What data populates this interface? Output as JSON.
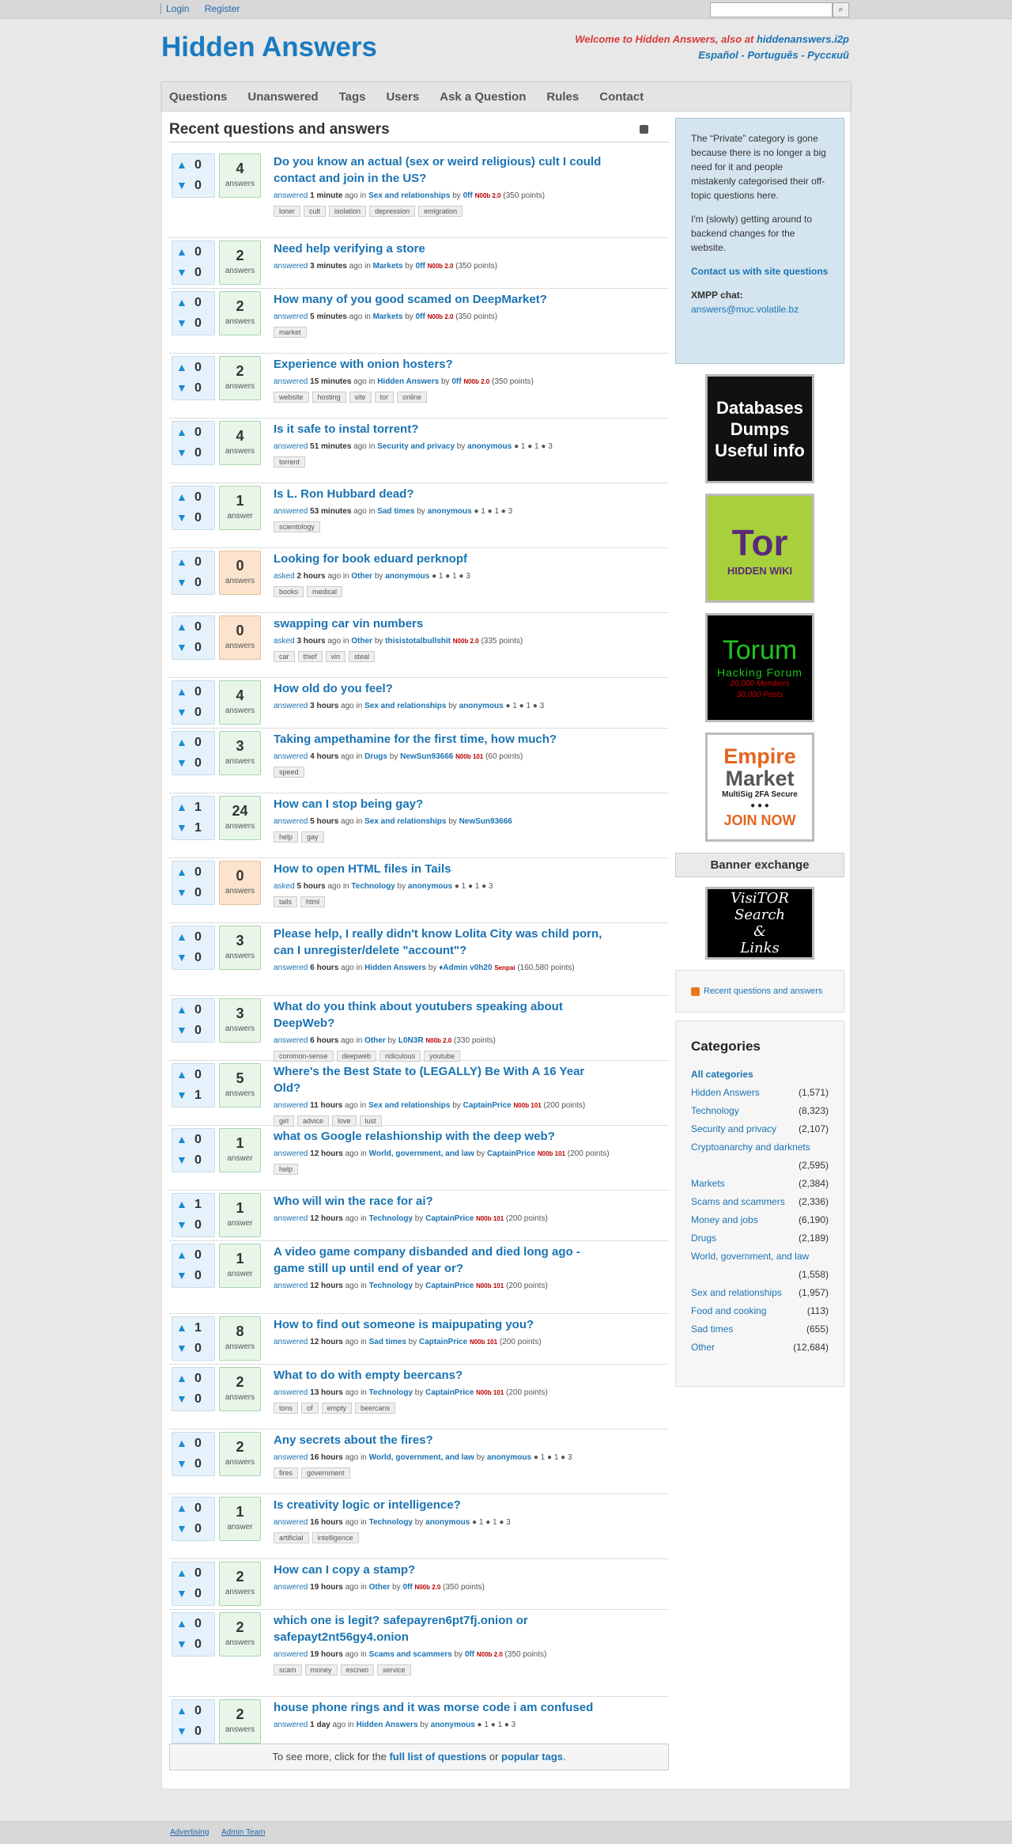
{
  "topbar": {
    "login": "Login",
    "register": "Register",
    "search_btn": "⌕"
  },
  "site": {
    "title": "Hidden Answers",
    "welcome_text": "Welcome to Hidden Answers, also at ",
    "welcome_link": "hiddenanswers.i2p",
    "languages": "Español - Português - Русский"
  },
  "nav": [
    "Questions",
    "Unanswered",
    "Tags",
    "Users",
    "Ask a Question",
    "Rules",
    "Contact"
  ],
  "heading": "Recent questions and answers",
  "questions": [
    {
      "up": "0",
      "down": "0",
      "count": "4",
      "unit": "answers",
      "title": "Do you know an actual (sex or weird religious) cult I could contact and join in the US?",
      "verb": "answered",
      "time": "1 minute",
      "cat": "Sex and relationships",
      "by": "0ff",
      "badge": "N00b 2.0",
      "pts": "(350 points)",
      "tags": [
        "loner",
        "cult",
        "isolation",
        "depression",
        "emigration"
      ],
      "h": 2
    },
    {
      "up": "0",
      "down": "0",
      "count": "2",
      "unit": "answers",
      "title": "Need help verifying a store",
      "verb": "answered",
      "time": "3 minutes",
      "cat": "Markets",
      "by": "0ff",
      "badge": "N00b 2.0",
      "pts": "(350 points)",
      "tags": [],
      "h": 1
    },
    {
      "up": "0",
      "down": "0",
      "count": "2",
      "unit": "answers",
      "title": "How many of you good scamed on DeepMarket?",
      "verb": "answered",
      "time": "5 minutes",
      "cat": "Markets",
      "by": "0ff",
      "badge": "N00b 2.0",
      "pts": "(350 points)",
      "tags": [
        "market"
      ],
      "h": 1
    },
    {
      "up": "0",
      "down": "0",
      "count": "2",
      "unit": "answers",
      "title": "Experience with onion hosters?",
      "verb": "answered",
      "time": "15 minutes",
      "cat": "Hidden Answers",
      "by": "0ff",
      "badge": "N00b 2.0",
      "pts": "(350 points)",
      "tags": [
        "website",
        "hosting",
        "site",
        "tor",
        "online"
      ],
      "h": 1
    },
    {
      "up": "0",
      "down": "0",
      "count": "4",
      "unit": "answers",
      "title": "Is it safe to instal torrent?",
      "verb": "answered",
      "time": "51 minutes",
      "cat": "Security and privacy",
      "by": "anonymous",
      "badge": "",
      "pts": "● 1 ● 1 ● 3",
      "tags": [
        "torrent"
      ],
      "h": 1
    },
    {
      "up": "0",
      "down": "0",
      "count": "1",
      "unit": "answer",
      "title": "Is L. Ron Hubbard dead?",
      "verb": "answered",
      "time": "53 minutes",
      "cat": "Sad times",
      "by": "anonymous",
      "badge": "",
      "pts": "● 1 ● 1 ● 3",
      "tags": [
        "scientology"
      ],
      "h": 1
    },
    {
      "up": "0",
      "down": "0",
      "count": "0",
      "unit": "answers",
      "title": "Looking for book eduard perknopf",
      "verb": "asked",
      "time": "2 hours",
      "cat": "Other",
      "by": "anonymous",
      "badge": "",
      "pts": "● 1 ● 1 ● 3",
      "tags": [
        "books",
        "medical"
      ],
      "h": 1,
      "zero": true
    },
    {
      "up": "0",
      "down": "0",
      "count": "0",
      "unit": "answers",
      "title": "swapping car vin numbers",
      "verb": "asked",
      "time": "3 hours",
      "cat": "Other",
      "by": "thisistotalbullshit",
      "badge": "N00b 2.0",
      "pts": "(335 points)",
      "tags": [
        "car",
        "thief",
        "vin",
        "steal"
      ],
      "h": 1,
      "zero": true
    },
    {
      "up": "0",
      "down": "0",
      "count": "4",
      "unit": "answers",
      "title": "How old do you feel?",
      "verb": "answered",
      "time": "3 hours",
      "cat": "Sex and relationships",
      "by": "anonymous",
      "badge": "",
      "pts": "● 1 ● 1 ● 3",
      "tags": [],
      "h": 1
    },
    {
      "up": "0",
      "down": "0",
      "count": "3",
      "unit": "answers",
      "title": "Taking ampethamine for the first time, how much?",
      "verb": "answered",
      "time": "4 hours",
      "cat": "Drugs",
      "by": "NewSun93666",
      "badge": "N00b 101",
      "pts": "(60 points)",
      "tags": [
        "speed"
      ],
      "h": 1
    },
    {
      "up": "1",
      "down": "1",
      "count": "24",
      "unit": "answers",
      "title": "How can I stop being gay?",
      "verb": "answered",
      "time": "5 hours",
      "cat": "Sex and relationships",
      "by": "NewSun93666",
      "badge": "",
      "pts": "",
      "tags": [
        "help",
        "gay"
      ],
      "h": 1
    },
    {
      "up": "0",
      "down": "0",
      "count": "0",
      "unit": "answers",
      "title": "How to open HTML files in Tails",
      "verb": "asked",
      "time": "5 hours",
      "cat": "Technology",
      "by": "anonymous",
      "badge": "",
      "pts": "● 1 ● 1 ● 3",
      "tags": [
        "tails",
        "html"
      ],
      "h": 1,
      "zero": true
    },
    {
      "up": "0",
      "down": "0",
      "count": "3",
      "unit": "answers",
      "title": "Please help, I really didn't know Lolita City was child porn, can I unregister/delete \"account\"?",
      "verb": "answered",
      "time": "6 hours",
      "cat": "Hidden Answers",
      "by": "♦Admin v0h20",
      "badge": "Senpai",
      "pts": "(160,580 points)",
      "tags": [],
      "h": 2
    },
    {
      "up": "0",
      "down": "0",
      "count": "3",
      "unit": "answers",
      "title": "What do you think about youtubers speaking about DeepWeb?",
      "verb": "answered",
      "time": "6 hours",
      "cat": "Other",
      "by": "L0N3R",
      "badge": "N00b 2.0",
      "pts": "(330 points)",
      "tags": [
        "common-sense",
        "deepweb",
        "ridiculous",
        "youtube"
      ],
      "h": 1
    },
    {
      "up": "0",
      "down": "1",
      "count": "5",
      "unit": "answers",
      "title": "Where's the Best State to (LEGALLY) Be With A 16 Year Old?",
      "verb": "answered",
      "time": "11 hours",
      "cat": "Sex and relationships",
      "by": "CaptainPrice",
      "badge": "N00b 101",
      "pts": "(200 points)",
      "tags": [
        "girl",
        "advice",
        "love",
        "lust"
      ],
      "h": 1
    },
    {
      "up": "0",
      "down": "0",
      "count": "1",
      "unit": "answer",
      "title": "what os Google relashionship with the deep web?",
      "verb": "answered",
      "time": "12 hours",
      "cat": "World, government, and law",
      "by": "CaptainPrice",
      "badge": "N00b 101",
      "pts": "(200 points)",
      "tags": [
        "help"
      ],
      "h": 1
    },
    {
      "up": "1",
      "down": "0",
      "count": "1",
      "unit": "answer",
      "title": "Who will win the race for ai?",
      "verb": "answered",
      "time": "12 hours",
      "cat": "Technology",
      "by": "CaptainPrice",
      "badge": "N00b 101",
      "pts": "(200 points)",
      "tags": [],
      "h": 1
    },
    {
      "up": "0",
      "down": "0",
      "count": "1",
      "unit": "answer",
      "title": "A video game company disbanded and died long ago - game still up until end of year or?",
      "verb": "answered",
      "time": "12 hours",
      "cat": "Technology",
      "by": "CaptainPrice",
      "badge": "N00b 101",
      "pts": "(200 points)",
      "tags": [],
      "h": 2
    },
    {
      "up": "1",
      "down": "0",
      "count": "8",
      "unit": "answers",
      "title": "How to find out someone is maipupating you?",
      "verb": "answered",
      "time": "12 hours",
      "cat": "Sad times",
      "by": "CaptainPrice",
      "badge": "N00b 101",
      "pts": "(200 points)",
      "tags": [],
      "h": 1
    },
    {
      "up": "0",
      "down": "0",
      "count": "2",
      "unit": "answers",
      "title": "What to do with empty beercans?",
      "verb": "answered",
      "time": "13 hours",
      "cat": "Technology",
      "by": "CaptainPrice",
      "badge": "N00b 101",
      "pts": "(200 points)",
      "tags": [
        "tons",
        "of",
        "empty",
        "beercans"
      ],
      "h": 1
    },
    {
      "up": "0",
      "down": "0",
      "count": "2",
      "unit": "answers",
      "title": "Any secrets about the fires?",
      "verb": "answered",
      "time": "16 hours",
      "cat": "World, government, and law",
      "by": "anonymous",
      "badge": "",
      "pts": "● 1 ● 1 ● 3",
      "tags": [
        "fires",
        "government"
      ],
      "h": 1
    },
    {
      "up": "0",
      "down": "0",
      "count": "1",
      "unit": "answer",
      "title": "Is creativity logic or intelligence?",
      "verb": "answered",
      "time": "16 hours",
      "cat": "Technology",
      "by": "anonymous",
      "badge": "",
      "pts": "● 1 ● 1 ● 3",
      "tags": [
        "artificial",
        "intelligence"
      ],
      "h": 1
    },
    {
      "up": "0",
      "down": "0",
      "count": "2",
      "unit": "answers",
      "title": "How can I copy a stamp?",
      "verb": "answered",
      "time": "19 hours",
      "cat": "Other",
      "by": "0ff",
      "badge": "N00b 2.0",
      "pts": "(350 points)",
      "tags": [],
      "h": 1
    },
    {
      "up": "0",
      "down": "0",
      "count": "2",
      "unit": "answers",
      "title": "which one is legit? safepayren6pt7fj.onion or safepayt2nt56gy4.onion",
      "verb": "answered",
      "time": "19 hours",
      "cat": "Scams and scammers",
      "by": "0ff",
      "badge": "N00b 2.0",
      "pts": "(350 points)",
      "tags": [
        "scam",
        "money",
        "escrwo",
        "service"
      ],
      "h": 2
    },
    {
      "up": "0",
      "down": "0",
      "count": "2",
      "unit": "answers",
      "title": "house phone rings and it was morse code i am confused",
      "verb": "answered",
      "time": "1 day",
      "cat": "Hidden Answers",
      "by": "anonymous",
      "badge": "",
      "pts": "● 1 ● 1 ● 3",
      "tags": [],
      "h": 1
    }
  ],
  "more": {
    "pre": "To see more, click for the ",
    "link1": "full list of questions",
    "mid": " or ",
    "link2": "popular tags",
    "post": "."
  },
  "sidebar": {
    "notice_p1": "The “Private” category is gone because there is no longer a big need for it and people mistakenly categorised their off-topic questions here.",
    "notice_p2": "I'm (slowly) getting around to backend changes for the website.",
    "contact": "Contact us with site questions",
    "xmpp_label": "XMPP chat:",
    "xmpp_addr": "answers@muc.volatile.bz",
    "ad1": [
      "Databases",
      "Dumps",
      "Useful info"
    ],
    "ad2": [
      "Tor",
      "HIDDEN WIKI"
    ],
    "ad3": [
      "Torum",
      "Hacking Forum",
      "20,000 Members",
      "30,000 Posts"
    ],
    "ad4": [
      "Empire",
      "Market",
      "MultiSig 2FA Secure",
      "JOIN NOW"
    ],
    "banner_exchange": "Banner exchange",
    "ad5": [
      "VisiTOR",
      "Search",
      "&",
      "Links"
    ],
    "rqa": "Recent questions and answers",
    "cats_title": "Categories",
    "cats_all": "All categories",
    "cats": [
      {
        "name": "Hidden Answers",
        "n": "(1,571)"
      },
      {
        "name": "Technology",
        "n": "(8,323)"
      },
      {
        "name": "Security and privacy",
        "n": "(2,107)"
      },
      {
        "name": "Cryptoanarchy and darknets",
        "n": "(2,595)",
        "wrap": true
      },
      {
        "name": "Markets",
        "n": "(2,384)"
      },
      {
        "name": "Scams and scammers",
        "n": "(2,336)"
      },
      {
        "name": "Money and jobs",
        "n": "(6,190)"
      },
      {
        "name": "Drugs",
        "n": "(2,189)"
      },
      {
        "name": "World, government, and law",
        "n": "(1,558)",
        "wrap": true
      },
      {
        "name": "Sex and relationships",
        "n": "(1,957)"
      },
      {
        "name": "Food and cooking",
        "n": "(113)"
      },
      {
        "name": "Sad times",
        "n": "(655)"
      },
      {
        "name": "Other",
        "n": "(12,684)"
      }
    ]
  },
  "footer": {
    "advertising": "Advertising",
    "admin_team": "Admin Team"
  }
}
